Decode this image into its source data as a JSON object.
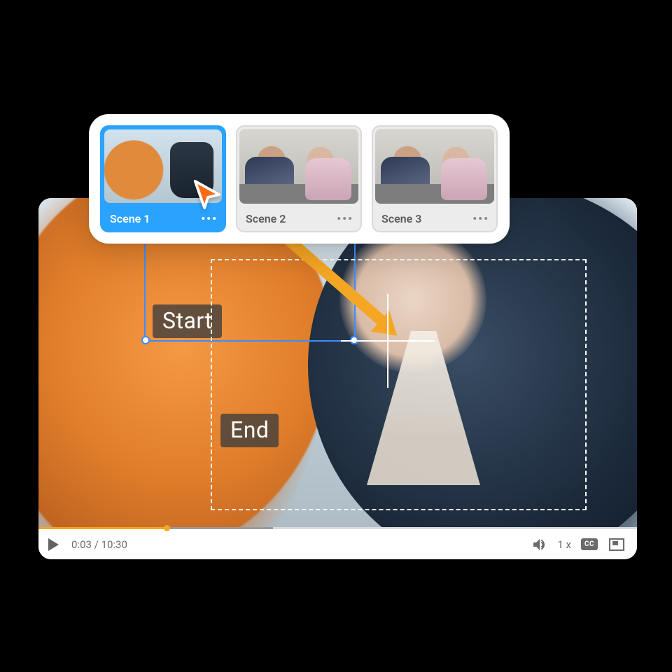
{
  "player": {
    "current_time": "0:03",
    "total_time": "10:30",
    "time_display": "0:03 / 10:30",
    "speed": "1 x",
    "cc_label": "CC"
  },
  "overlay": {
    "start_label": "Start",
    "end_label": "End"
  },
  "scenes": [
    {
      "label": "Scene 1",
      "selected": true
    },
    {
      "label": "Scene 2",
      "selected": false
    },
    {
      "label": "Scene 3",
      "selected": false
    }
  ],
  "icons": {
    "play": "play-icon",
    "volume": "volume-icon",
    "cc": "cc-icon",
    "fullscreen": "fullscreen-icon",
    "more": "•••",
    "cursor": "cursor-icon"
  },
  "colors": {
    "accent": "#2aa3ff",
    "progress": "#f5a623",
    "arrow": "#f5a623"
  }
}
